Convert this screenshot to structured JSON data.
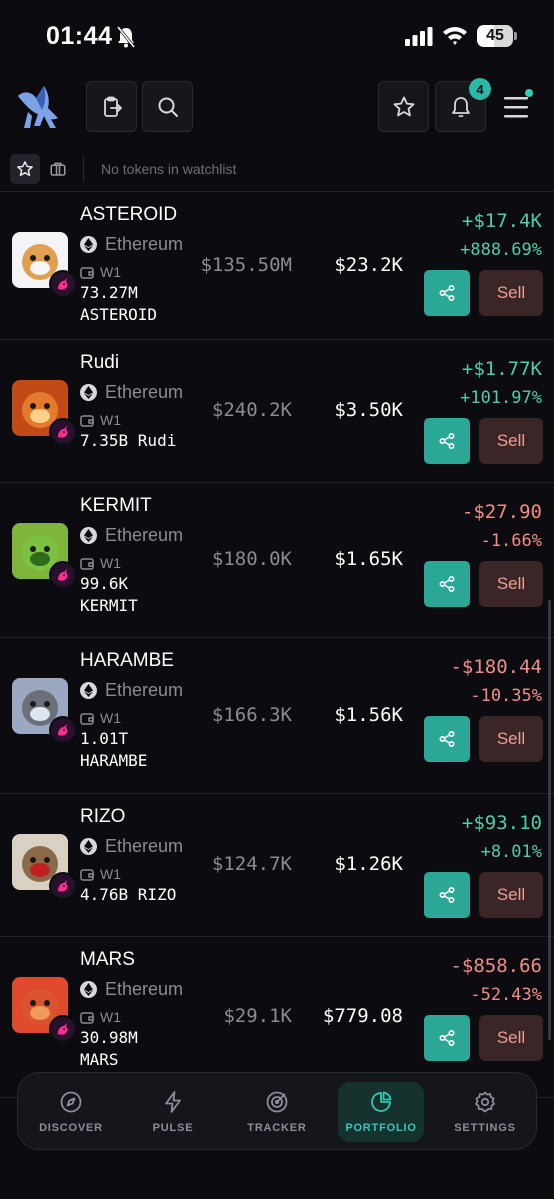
{
  "status_bar": {
    "time": "01:44",
    "battery": "45"
  },
  "header": {
    "notification_count": "4"
  },
  "watchlist": {
    "empty_text": "No tokens in watchlist"
  },
  "tokens": [
    {
      "name": "ASTEROID",
      "chain": "Ethereum",
      "wallet": "W1",
      "holding_line1": "73.27M",
      "holding_line2": "ASTEROID",
      "market_cap": "$135.50M",
      "value": "$23.2K",
      "pnl": "+$17.4K",
      "pnl_pct": "+888.69%",
      "trend": "positive",
      "share_label": "share",
      "sell_label": "Sell"
    },
    {
      "name": "Rudi",
      "chain": "Ethereum",
      "wallet": "W1",
      "holding_line1": "7.35B Rudi",
      "holding_line2": "",
      "market_cap": "$240.2K",
      "value": "$3.50K",
      "pnl": "+$1.77K",
      "pnl_pct": "+101.97%",
      "trend": "positive",
      "share_label": "share",
      "sell_label": "Sell"
    },
    {
      "name": "KERMIT",
      "chain": "Ethereum",
      "wallet": "W1",
      "holding_line1": "99.6K",
      "holding_line2": "KERMIT",
      "market_cap": "$180.0K",
      "value": "$1.65K",
      "pnl": "-$27.90",
      "pnl_pct": "-1.66%",
      "trend": "negative",
      "share_label": "share",
      "sell_label": "Sell"
    },
    {
      "name": "HARAMBE",
      "chain": "Ethereum",
      "wallet": "W1",
      "holding_line1": "1.01T",
      "holding_line2": "HARAMBE",
      "market_cap": "$166.3K",
      "value": "$1.56K",
      "pnl": "-$180.44",
      "pnl_pct": "-10.35%",
      "trend": "negative",
      "share_label": "share",
      "sell_label": "Sell"
    },
    {
      "name": "RIZO",
      "chain": "Ethereum",
      "wallet": "W1",
      "holding_line1": "4.76B RIZO",
      "holding_line2": "",
      "market_cap": "$124.7K",
      "value": "$1.26K",
      "pnl": "+$93.10",
      "pnl_pct": "+8.01%",
      "trend": "positive",
      "share_label": "share",
      "sell_label": "Sell"
    },
    {
      "name": "MARS",
      "chain": "Ethereum",
      "wallet": "W1",
      "holding_line1": "30.98M",
      "holding_line2": "MARS",
      "market_cap": "$29.1K",
      "value": "$779.08",
      "pnl": "-$858.66",
      "pnl_pct": "-52.43%",
      "trend": "negative",
      "share_label": "share",
      "sell_label": "Sell"
    }
  ],
  "nav": {
    "discover": "DISCOVER",
    "pulse": "PULSE",
    "tracker": "TRACKER",
    "portfolio": "PORTFOLIO",
    "settings": "SETTINGS",
    "active": "portfolio"
  },
  "colors": {
    "accent": "#2aa895",
    "positive": "#4fcca9",
    "negative": "#f08d86",
    "sell_bg": "#3a2527",
    "background": "#0b0b10"
  },
  "icons": [
    "bell-slash-icon",
    "signal-icon",
    "wifi-icon",
    "battery-icon",
    "app-logo",
    "clipboard-export-icon",
    "search-icon",
    "star-icon",
    "bell-icon",
    "menu-icon",
    "briefcase-icon",
    "ethereum-icon",
    "wallet-icon",
    "share-icon",
    "compass-icon",
    "lightning-icon",
    "target-icon",
    "pie-chart-icon",
    "gear-icon"
  ]
}
